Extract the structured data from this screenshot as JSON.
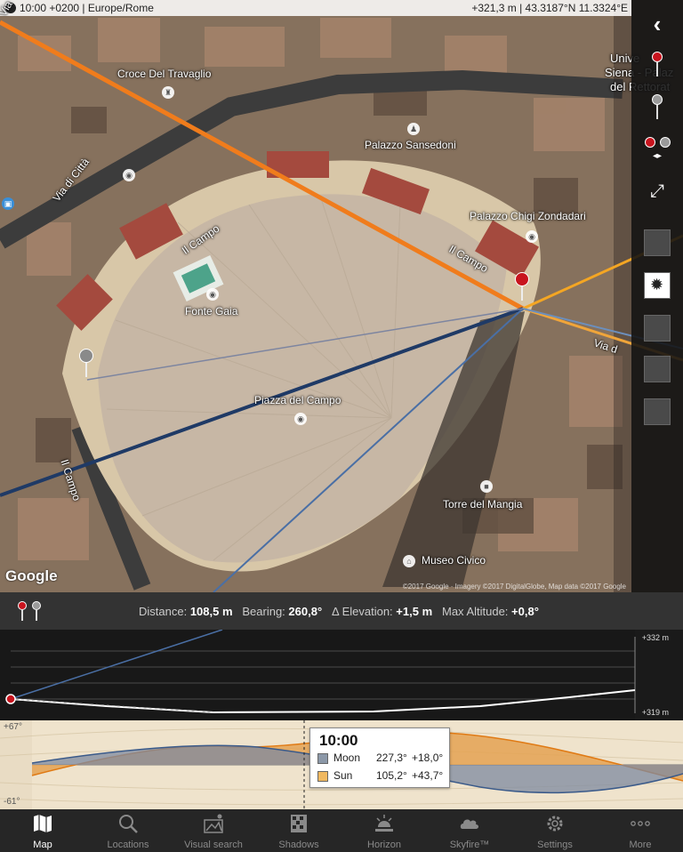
{
  "status": {
    "time_zone": "10:00 +0200 | Europe/Rome",
    "location": "+321,3 m | 43.3187°N 11.3324°E"
  },
  "map": {
    "pois": [
      {
        "name": "Croce Del Travaglio"
      },
      {
        "name": "Palazzo Sansedoni"
      },
      {
        "name": "Palazzo Chigi Zondadari"
      },
      {
        "name": "Fonte Gaia"
      },
      {
        "name": "Piazza del Campo"
      },
      {
        "name": "Torre del Mangia"
      },
      {
        "name": "Museo Civico"
      }
    ],
    "streets": {
      "via_citta": "Via di Città",
      "campo_1": "Il Campo",
      "campo_2": "Il Campo",
      "campo_3": "Il Campo",
      "via_right": "Via d",
      "via_top": "Via",
      "unive": "Unive",
      "siena": "Siena - Palaz",
      "rettor": "del Rettorat"
    },
    "logo": "Google",
    "copyright": "©2017 Google · Imagery ©2017 DigitalGlobe, Map data ©2017 Google"
  },
  "info": {
    "distance_label": "Distance:",
    "distance_value": "108,5 m",
    "bearing_label": "Bearing:",
    "bearing_value": "260,8°",
    "elevation_label": "Δ Elevation:",
    "elevation_value": "+1,5 m",
    "max_altitude_label": "Max Altitude:",
    "max_altitude_value": "+0,8°"
  },
  "profile": {
    "top_label": "+332 m",
    "bottom_label": "+319 m"
  },
  "sunmoon": {
    "top_label": "+67°",
    "bottom_label": "-61°",
    "tooltip": {
      "time": "10:00",
      "moon": {
        "name": "Moon",
        "azimuth": "227,3°",
        "elevation": "+18,0°",
        "color": "#8c98a8"
      },
      "sun": {
        "name": "Sun",
        "azimuth": "105,2°",
        "elevation": "+43,7°",
        "color": "#f0b860"
      }
    }
  },
  "tabs": [
    {
      "label": "Map",
      "icon": "map-icon",
      "active": true
    },
    {
      "label": "Locations",
      "icon": "magnifier-icon"
    },
    {
      "label": "Visual search",
      "icon": "visual-search-icon"
    },
    {
      "label": "Shadows",
      "icon": "shadows-icon"
    },
    {
      "label": "Horizon",
      "icon": "horizon-icon"
    },
    {
      "label": "Skyfire™",
      "icon": "skyfire-icon"
    },
    {
      "label": "Settings",
      "icon": "gear-icon"
    },
    {
      "label": "More",
      "icon": "more-dots-icon"
    }
  ],
  "colors": {
    "sun_line": "#f07c1c",
    "sunset_line": "#f4a623",
    "moon_line": "#1f3a66",
    "pin_red": "#c8141e",
    "pin_grey": "#9a9a9a"
  }
}
